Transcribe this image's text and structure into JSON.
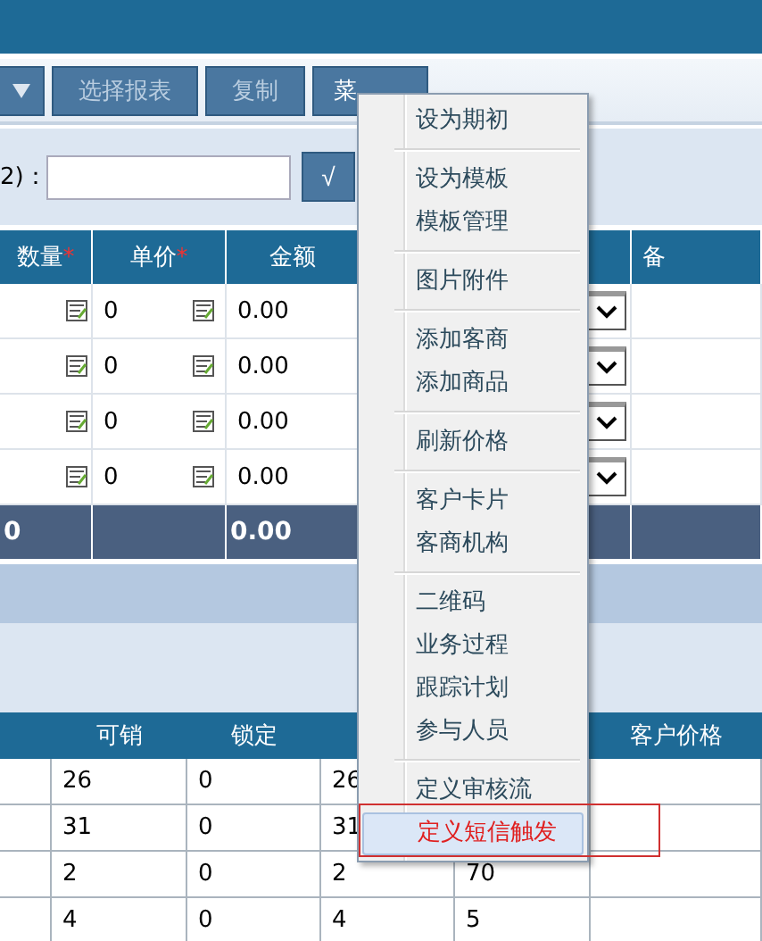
{
  "toolbar": {
    "buttons": [
      {
        "kind": "dropdown"
      },
      {
        "kind": "text",
        "label": "选择报表"
      },
      {
        "kind": "text",
        "label": "复制"
      },
      {
        "kind": "menu",
        "label": "菜"
      }
    ]
  },
  "filter": {
    "label": "2)：",
    "confirm": "√"
  },
  "table": {
    "columns": [
      {
        "label": "数量",
        "required_mark": "*"
      },
      {
        "label": "单价",
        "required_mark": "*"
      },
      {
        "label": "金额"
      },
      {
        "label": "备"
      }
    ],
    "rows": [
      {
        "price": "0",
        "amount": "0.00"
      },
      {
        "price": "0",
        "amount": "0.00"
      },
      {
        "price": "0",
        "amount": "0.00"
      },
      {
        "price": "0",
        "amount": "0.00"
      }
    ],
    "totals": {
      "qty": "0",
      "amount": "0.00"
    }
  },
  "stock_table": {
    "columns": [
      null,
      "可销",
      "锁定",
      null,
      null,
      "客户价格"
    ],
    "rows": [
      [
        null,
        "26",
        "0",
        "26",
        null,
        null
      ],
      [
        null,
        "31",
        "0",
        "31",
        null,
        null
      ],
      [
        null,
        "2",
        "0",
        "2",
        "70",
        null
      ],
      [
        null,
        "4",
        "0",
        "4",
        "5",
        null
      ]
    ]
  },
  "menu": {
    "groups": [
      [
        {
          "label": "设为期初",
          "selected": false
        }
      ],
      [
        {
          "label": "设为模板",
          "selected": false
        },
        {
          "label": "模板管理",
          "selected": false
        }
      ],
      [
        {
          "label": "图片附件",
          "selected": false
        }
      ],
      [
        {
          "label": "添加客商",
          "selected": false
        },
        {
          "label": "添加商品",
          "selected": false
        }
      ],
      [
        {
          "label": "刷新价格",
          "selected": false
        }
      ],
      [
        {
          "label": "客户卡片",
          "selected": false
        },
        {
          "label": "客商机构",
          "selected": false
        }
      ],
      [
        {
          "label": "二维码",
          "selected": false
        },
        {
          "label": "业务过程",
          "selected": false
        },
        {
          "label": "跟踪计划",
          "selected": false
        },
        {
          "label": "参与人员",
          "selected": false
        }
      ],
      [
        {
          "label": "定义审核流",
          "selected": false
        },
        {
          "label": "定义短信触发",
          "selected": true
        }
      ]
    ]
  }
}
